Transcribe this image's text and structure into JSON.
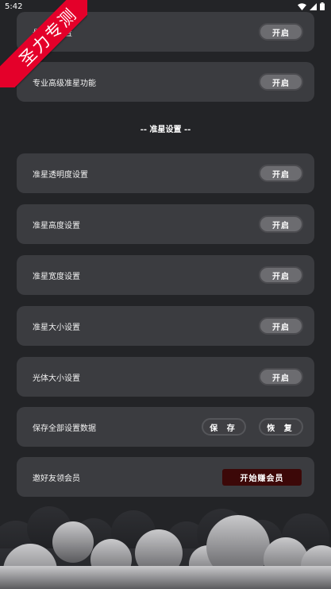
{
  "status_bar": {
    "time": "5:42"
  },
  "ribbon": {
    "text": "圣力专测"
  },
  "section_title": "-- 准星设置 --",
  "cards": [
    {
      "label": "悬浮窗设置",
      "button": "开启"
    },
    {
      "label": "专业高级准星功能",
      "button": "开启"
    },
    {
      "label": "准星透明度设置",
      "button": "开启"
    },
    {
      "label": "准星高度设置",
      "button": "开启"
    },
    {
      "label": "准星宽度设置",
      "button": "开启"
    },
    {
      "label": "准星大小设置",
      "button": "开启"
    },
    {
      "label": "光体大小设置",
      "button": "开启"
    }
  ],
  "save_card": {
    "label": "保存全部设置数据",
    "save_button": "保 存",
    "restore_button": "恢 复"
  },
  "invite_card": {
    "label": "邀好友领会员",
    "button": "开始赚会员"
  },
  "colors": {
    "background": "#232427",
    "card": "#3b3c40",
    "ribbon": "#e4002a",
    "member_button": "#3c0808"
  }
}
